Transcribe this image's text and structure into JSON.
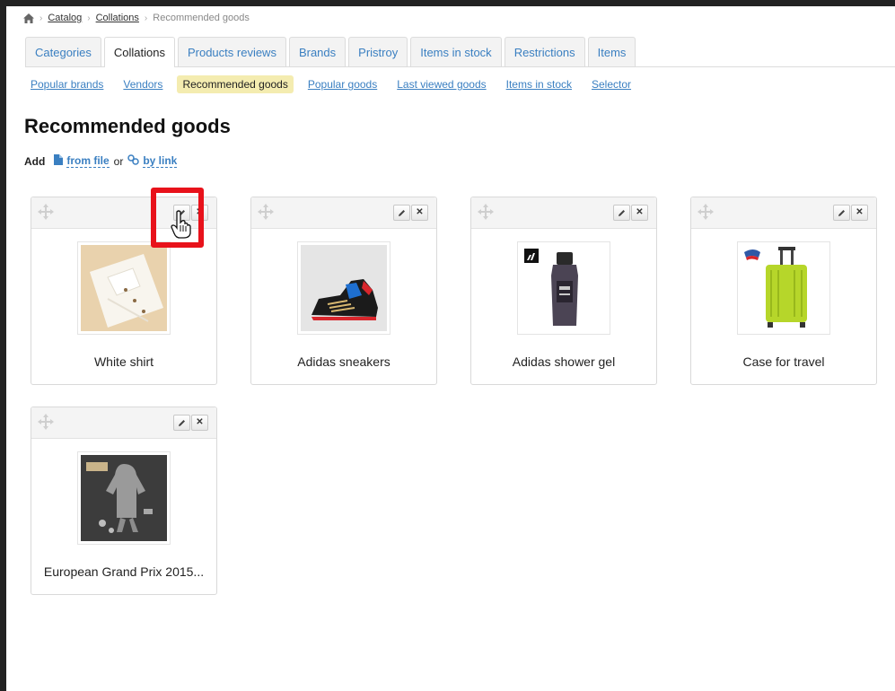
{
  "breadcrumb": {
    "home_icon": "home-icon",
    "items": [
      "Catalog",
      "Collations"
    ],
    "current": "Recommended goods"
  },
  "tabs": [
    {
      "label": "Categories",
      "active": false
    },
    {
      "label": "Collations",
      "active": true
    },
    {
      "label": "Products reviews",
      "active": false
    },
    {
      "label": "Brands",
      "active": false
    },
    {
      "label": "Pristroy",
      "active": false
    },
    {
      "label": "Items in stock",
      "active": false
    },
    {
      "label": "Restrictions",
      "active": false
    },
    {
      "label": "Items",
      "active": false
    }
  ],
  "subnav": [
    {
      "label": "Popular brands",
      "active": false
    },
    {
      "label": "Vendors",
      "active": false
    },
    {
      "label": "Recommended goods",
      "active": true
    },
    {
      "label": "Popular goods",
      "active": false
    },
    {
      "label": "Last viewed goods",
      "active": false
    },
    {
      "label": "Items in stock",
      "active": false
    },
    {
      "label": "Selector",
      "active": false
    }
  ],
  "page_title": "Recommended goods",
  "add": {
    "label": "Add",
    "from_file": "from file",
    "or": "or",
    "by_link": "by link"
  },
  "products": [
    {
      "title": "White shirt",
      "image": "white-shirt-image"
    },
    {
      "title": "Adidas sneakers",
      "image": "adidas-sneakers-image"
    },
    {
      "title": "Adidas shower gel",
      "image": "adidas-shower-gel-image"
    },
    {
      "title": "Case for travel",
      "image": "travel-case-image"
    },
    {
      "title": "European Grand Prix 2015...",
      "image": "grand-prix-jacket-image"
    }
  ],
  "colors": {
    "link": "#3a7fc1",
    "active_subnav_bg": "#f4ecb0",
    "highlight": "#e8121b"
  }
}
